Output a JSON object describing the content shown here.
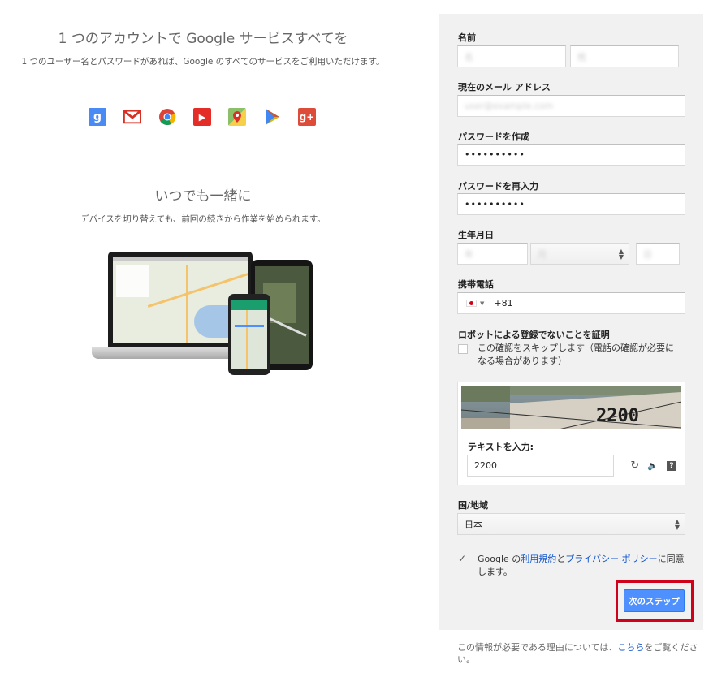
{
  "left": {
    "headline": "1 つのアカウントで Google サービスすべてを",
    "subtext": "1 つのユーザー名とパスワードがあれば、Google のすべてのサービスをご利用いただけます。",
    "icons": [
      {
        "name": "google-search-icon",
        "glyph": "g",
        "color": "#4a8af4"
      },
      {
        "name": "gmail-icon",
        "glyph": "M",
        "color": "#ffffff"
      },
      {
        "name": "chrome-icon",
        "glyph": "",
        "color": "#ffffff"
      },
      {
        "name": "youtube-icon",
        "glyph": "▶",
        "color": "#e52d27"
      },
      {
        "name": "maps-icon",
        "glyph": "",
        "color": "#8cc068"
      },
      {
        "name": "play-icon",
        "glyph": "▶",
        "color": "#ffffff"
      },
      {
        "name": "google-plus-icon",
        "glyph": "g+",
        "color": "#dd4b39"
      }
    ],
    "headline2": "いつでも一緒に",
    "subtext2": "デバイスを切り替えても、前回の続きから作業を始められます。"
  },
  "form": {
    "name_label": "名前",
    "first_name": "名",
    "last_name": "姓",
    "email_label": "現在のメール アドレス",
    "email_value": "user@example.com",
    "password_label": "パスワードを作成",
    "password_value": "••••••••••",
    "password_confirm_label": "パスワードを再入力",
    "password_confirm_value": "••••••••••",
    "birthday_label": "生年月日",
    "birth_year": "年",
    "birth_month": "月",
    "birth_day": "日",
    "phone_label": "携帯電話",
    "phone_country_code": "+81",
    "robot_label": "ロボットによる登録でないことを証明",
    "skip_text": "この確認をスキップします（電話の確認が必要になる場合があります）",
    "captcha_image_text": "2200",
    "captcha_label": "テキストを入力:",
    "captcha_value": "2200",
    "country_label": "国/地域",
    "country_value": "日本",
    "terms_prefix": "Google の",
    "terms_link": "利用規約",
    "terms_and": "と",
    "privacy_link": "プライバシー ポリシー",
    "terms_suffix": "に同意します。",
    "next_button": "次のステップ"
  },
  "footnote": {
    "prefix": "この情報が必要である理由については、",
    "link": "こちら",
    "suffix": "をご覧ください。"
  },
  "colors": {
    "accent_blue": "#4d90fe",
    "link_blue": "#1155cc",
    "highlight_red": "#d0021b",
    "panel_bg": "#f1f1f1"
  }
}
